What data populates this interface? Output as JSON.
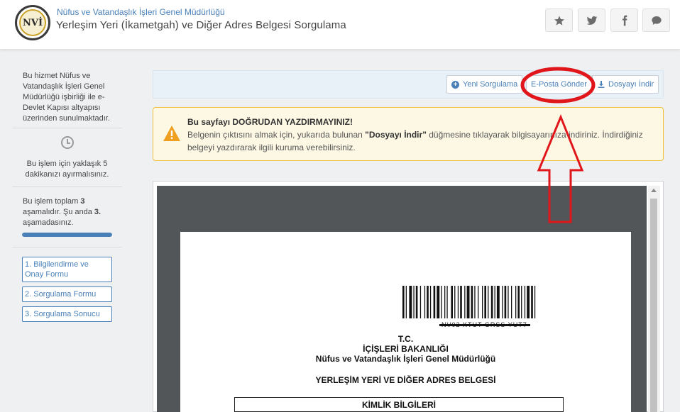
{
  "header": {
    "org_name": "Nüfus ve Vatandaşlık İşleri Genel Müdürlüğü",
    "page_title": "Yerleşim Yeri (İkametgah) ve Diğer Adres Belgesi Sorgulama",
    "logo_text": "NVİ",
    "icons": [
      "star-icon",
      "twitter-icon",
      "facebook-icon",
      "comment-icon"
    ]
  },
  "sidebar": {
    "info_text": "Bu hizmet Nüfus ve Vatandaşlık İşleri Genel Müdürlüğü işbirliği ile e-Devlet Kapısı altyapısı üzerinden sunulmaktadır.",
    "duration_text": "Bu işlem için yaklaşık 5 dakikanızı ayırmalısınız.",
    "progress": {
      "text_1": "Bu işlem toplam ",
      "total": "3",
      "text_2": " aşamalıdır. Şu anda ",
      "current": "3.",
      "text_3": " aşamadasınız.",
      "fraction": 1.0
    },
    "steps": [
      {
        "label": "1. Bilgilendirme ve Onay Formu"
      },
      {
        "label": "2. Sorgulama Formu"
      },
      {
        "label": "3. Sorgulama Sonucu"
      }
    ]
  },
  "toolbar": {
    "new_query": "Yeni Sorgulama",
    "send_email": "E-Posta Gönder",
    "download": "Dosyayı İndir"
  },
  "warning": {
    "title": "Bu sayfayı DOĞRUDAN YAZDIRMAYINIZ!",
    "body_1": "Belgenin çıktısını almak için, yukarıda bulunan ",
    "body_bold": "\"Dosyayı İndir\"",
    "body_2": " düğmesine tıklayarak bilgisayarınıza indiriniz. İndirdiğiniz belgeyi yazdırarak ilgili kuruma verebilirsiniz."
  },
  "document": {
    "barcode_text": "NV02 KTUT GRSS YUT7",
    "line_tc": "T.C.",
    "line_ministry": "İÇİŞLERİ BAKANLIĞI",
    "line_directorate": "Nüfus ve Vatandaşlık İşleri Genel Müdürlüğü",
    "line_doc_title": "YERLEŞİM YERİ VE DİĞER ADRES BELGESİ",
    "section_identity": "KİMLİK BİLGİLERİ"
  },
  "colors": {
    "accent": "#4a80b8",
    "warning_border": "#f0c040",
    "warning_bg": "#fdf8e4",
    "annotation_red": "#e0161b",
    "viewer_dark": "#525659"
  }
}
